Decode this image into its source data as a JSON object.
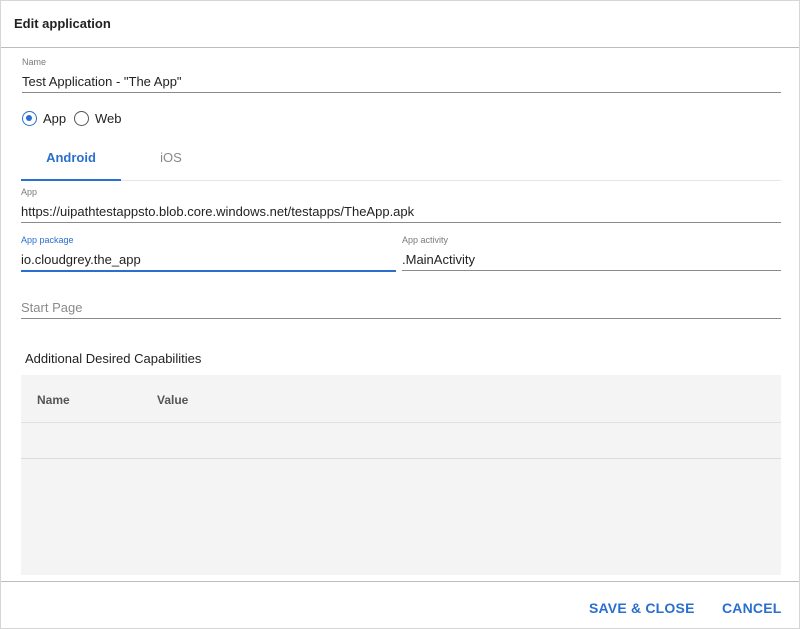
{
  "dialog": {
    "title": "Edit application"
  },
  "name_field": {
    "label": "Name",
    "value": "Test Application - \"The App\""
  },
  "app_type": {
    "options": [
      {
        "label": "App",
        "checked": true
      },
      {
        "label": "Web",
        "checked": false
      }
    ]
  },
  "platform_tabs": [
    {
      "label": "Android",
      "active": true
    },
    {
      "label": "iOS",
      "active": false
    }
  ],
  "app_field": {
    "label": "App",
    "value": "https://uipathtestappsto.blob.core.windows.net/testapps/TheApp.apk"
  },
  "app_package_field": {
    "label": "App package",
    "value": "io.cloudgrey.the_app"
  },
  "app_activity_field": {
    "label": "App activity",
    "value": ".MainActivity"
  },
  "start_page_field": {
    "placeholder": "Start Page",
    "value": ""
  },
  "capabilities": {
    "title": "Additional Desired Capabilities",
    "columns": [
      "Name",
      "Value"
    ],
    "rows": []
  },
  "footer": {
    "save_label": "SAVE & CLOSE",
    "cancel_label": "CANCEL"
  },
  "colors": {
    "accent": "#2a6fcf",
    "divider": "#bdbdbd",
    "grid_bg": "#f4f4f4"
  }
}
